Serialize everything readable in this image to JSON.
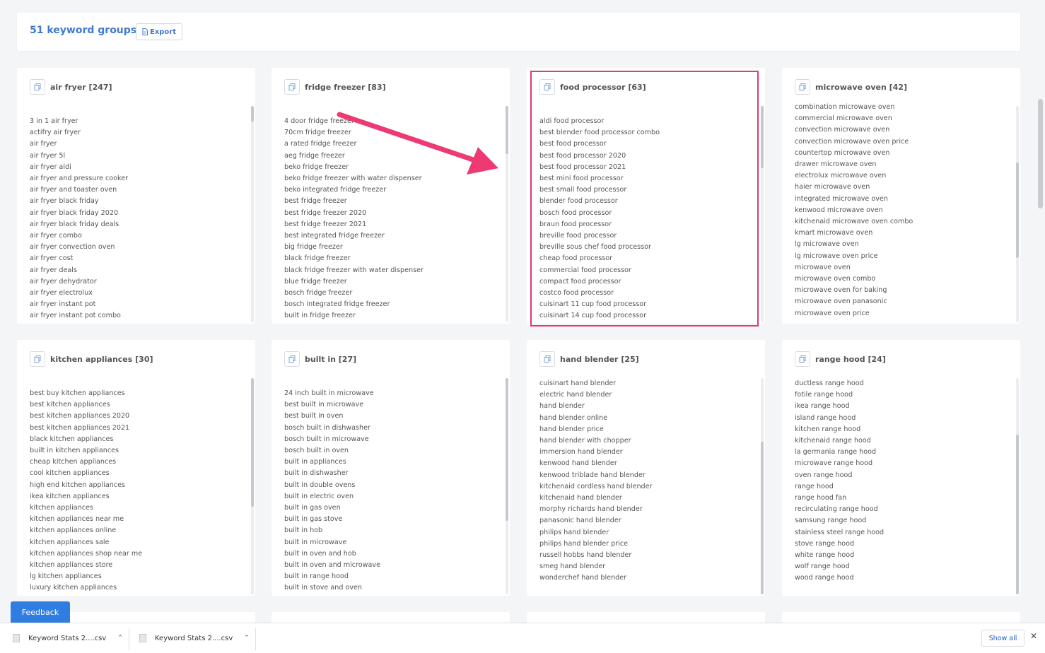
{
  "header": {
    "title": "51 keyword groups.",
    "export_label": "Export"
  },
  "groups": [
    {
      "title": "air fryer [247]",
      "keywords": [
        "3 in 1 air fryer",
        "actifry air fryer",
        "air fryer",
        "air fryer 5l",
        "air fryer aldi",
        "air fryer and pressure cooker",
        "air fryer and toaster oven",
        "air fryer black friday",
        "air fryer black friday 2020",
        "air fryer black friday deals",
        "air fryer combo",
        "air fryer convection oven",
        "air fryer cost",
        "air fryer deals",
        "air fryer dehydrator",
        "air fryer electrolux",
        "air fryer instant pot",
        "air fryer instant pot combo"
      ]
    },
    {
      "title": "fridge freezer [83]",
      "keywords": [
        "4 door fridge freezer",
        "70cm fridge freezer",
        "a rated fridge freezer",
        "aeg fridge freezer",
        "beko fridge freezer",
        "beko fridge freezer with water dispenser",
        "beko integrated fridge freezer",
        "best fridge freezer",
        "best fridge freezer 2020",
        "best fridge freezer 2021",
        "best integrated fridge freezer",
        "big fridge freezer",
        "black fridge freezer",
        "black fridge freezer with water dispenser",
        "blue fridge freezer",
        "bosch fridge freezer",
        "bosch integrated fridge freezer",
        "built in fridge freezer"
      ]
    },
    {
      "title": "food processor [63]",
      "keywords": [
        "aldi food processor",
        "best blender food processor combo",
        "best food processor",
        "best food processor 2020",
        "best food processor 2021",
        "best mini food processor",
        "best small food processor",
        "blender food processor",
        "bosch food processor",
        "braun food processor",
        "breville food processor",
        "breville sous chef food processor",
        "cheap food processor",
        "commercial food processor",
        "compact food processor",
        "costco food processor",
        "cuisinart 11 cup food processor",
        "cuisinart 14 cup food processor"
      ]
    },
    {
      "title": "microwave oven [42]",
      "keywords": [
        "combination microwave oven",
        "commercial microwave oven",
        "convection microwave oven",
        "convection microwave oven price",
        "countertop microwave oven",
        "drawer microwave oven",
        "electrolux microwave oven",
        "haier microwave oven",
        "integrated microwave oven",
        "kenwood microwave oven",
        "kitchenaid microwave oven combo",
        "kmart microwave oven",
        "lg microwave oven",
        "lg microwave oven price",
        "microwave oven",
        "microwave oven combo",
        "microwave oven for baking",
        "microwave oven panasonic",
        "microwave oven price"
      ]
    },
    {
      "title": "kitchen appliances [30]",
      "keywords": [
        "best buy kitchen appliances",
        "best kitchen appliances",
        "best kitchen appliances 2020",
        "best kitchen appliances 2021",
        "black kitchen appliances",
        "built in kitchen appliances",
        "cheap kitchen appliances",
        "cool kitchen appliances",
        "high end kitchen appliances",
        "ikea kitchen appliances",
        "kitchen appliances",
        "kitchen appliances near me",
        "kitchen appliances online",
        "kitchen appliances sale",
        "kitchen appliances shop near me",
        "kitchen appliances store",
        "lg kitchen appliances",
        "luxury kitchen appliances"
      ]
    },
    {
      "title": "built in [27]",
      "keywords": [
        "24 inch built in microwave",
        "best built in microwave",
        "best built in oven",
        "bosch built in dishwasher",
        "bosch built in microwave",
        "bosch built in oven",
        "built in appliances",
        "built in dishwasher",
        "built in double ovens",
        "built in electric oven",
        "built in gas oven",
        "built in gas stove",
        "built in hob",
        "built in microwave",
        "built in oven and hob",
        "built in oven and microwave",
        "built in range hood",
        "built in stove and oven"
      ]
    },
    {
      "title": "hand blender [25]",
      "keywords": [
        "cuisinart hand blender",
        "electric hand blender",
        "hand blender",
        "hand blender online",
        "hand blender price",
        "hand blender with chopper",
        "immersion hand blender",
        "kenwood hand blender",
        "kenwood triblade hand blender",
        "kitchenaid cordless hand blender",
        "kitchenaid hand blender",
        "morphy richards hand blender",
        "panasonic hand blender",
        "philips hand blender",
        "philips hand blender price",
        "russell hobbs hand blender",
        "smeg hand blender",
        "wonderchef hand blender"
      ]
    },
    {
      "title": "range hood [24]",
      "keywords": [
        "ductless range hood",
        "fotile range hood",
        "ikea range hood",
        "island range hood",
        "kitchen range hood",
        "kitchenaid range hood",
        "la germania range hood",
        "microwave range hood",
        "oven range hood",
        "range hood",
        "range hood fan",
        "recirculating range hood",
        "samsung range hood",
        "stainless steel range hood",
        "stove range hood",
        "white range hood",
        "wolf range hood",
        "wood range hood"
      ]
    }
  ],
  "feedback_label": "Feedback",
  "downloads": [
    {
      "name": "Keyword Stats 2....csv"
    },
    {
      "name": "Keyword Stats 2....csv"
    }
  ],
  "show_all_label": "Show all",
  "close_label": "✕"
}
